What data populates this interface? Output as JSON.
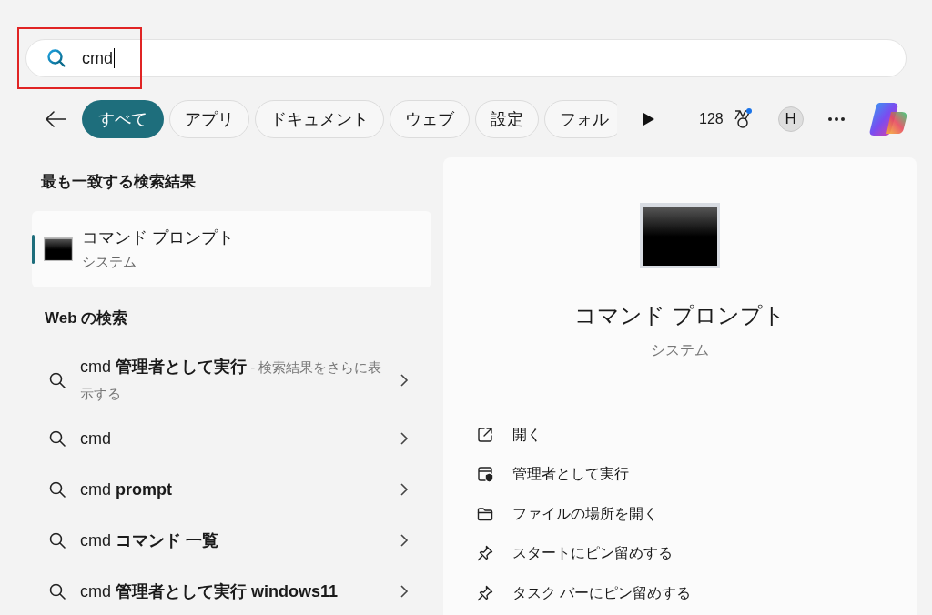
{
  "search": {
    "value": "cmd",
    "highlighted": true
  },
  "filters": [
    {
      "label": "すべて",
      "selected": true
    },
    {
      "label": "アプリ",
      "selected": false
    },
    {
      "label": "ドキュメント",
      "selected": false
    },
    {
      "label": "ウェブ",
      "selected": false
    },
    {
      "label": "設定",
      "selected": false
    },
    {
      "label": "フォル",
      "selected": false
    }
  ],
  "points": "128",
  "avatar": "H",
  "best_match": {
    "heading": "最も一致する検索結果",
    "title": "コマンド プロンプト",
    "subtitle": "システム",
    "selected": true
  },
  "web_search": {
    "heading": "Web の検索",
    "items": [
      {
        "text": "cmd **管理者として実行**",
        "note": "- 検索結果をさらに表示する"
      },
      {
        "text": "cmd"
      },
      {
        "text": "cmd **prompt**"
      },
      {
        "text": "cmd **コマンド 一覧**"
      },
      {
        "text": "cmd **管理者として実行 windows11**"
      }
    ]
  },
  "details": {
    "title": "コマンド プロンプト",
    "subtitle": "システム",
    "actions": [
      {
        "kind": "open",
        "label": "開く"
      },
      {
        "kind": "admin",
        "label": "管理者として実行"
      },
      {
        "kind": "folder",
        "label": "ファイルの場所を開く"
      },
      {
        "kind": "pin",
        "label": "スタートにピン留めする"
      },
      {
        "kind": "pin",
        "label": "タスク バーにピン留めする"
      }
    ]
  }
}
